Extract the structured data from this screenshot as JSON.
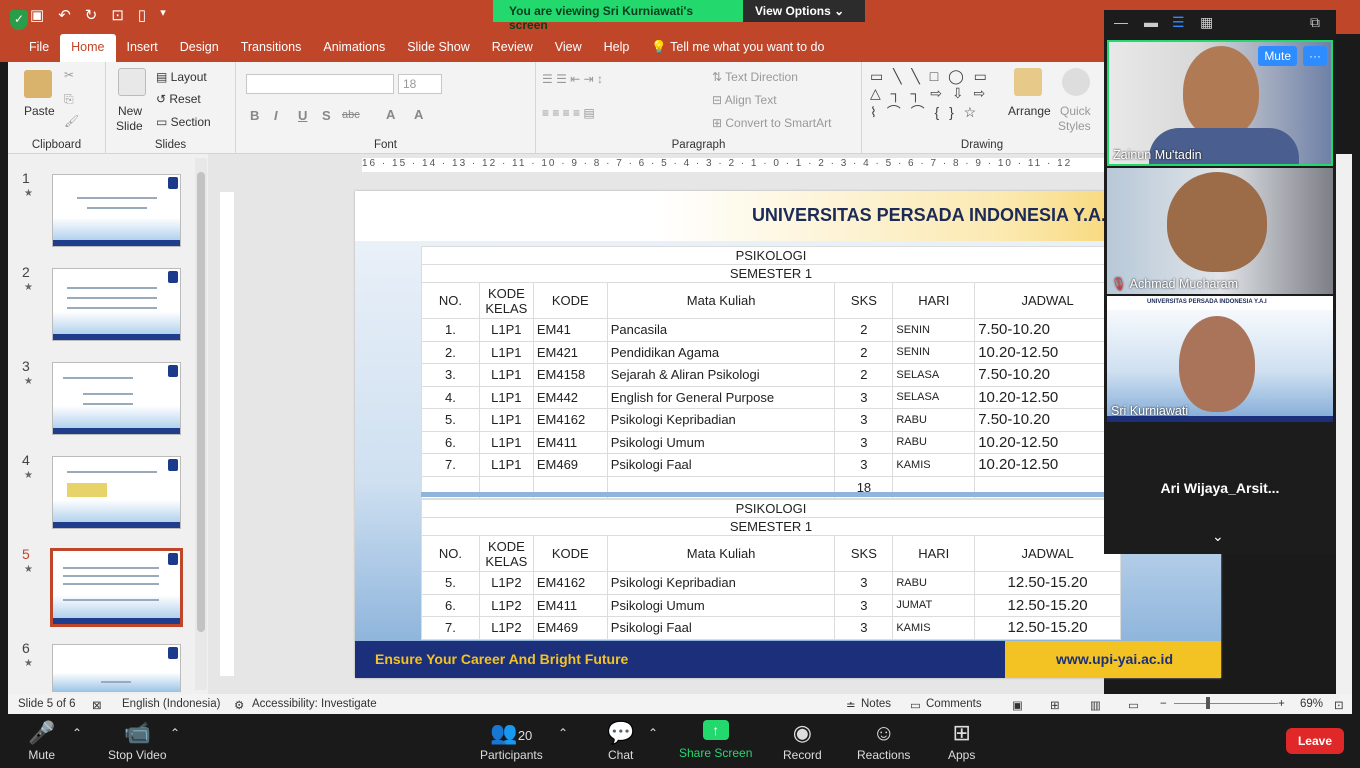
{
  "window": {
    "quick_access": [
      "save-icon",
      "undo-icon",
      "redo-icon",
      "present-icon",
      "new-icon",
      "customize-icon"
    ],
    "share_banner": "You are viewing Sri Kurniawati's screen",
    "view_options": "View Options"
  },
  "ribbon": {
    "tabs": [
      "File",
      "Home",
      "Insert",
      "Design",
      "Transitions",
      "Animations",
      "Slide Show",
      "Review",
      "View",
      "Help"
    ],
    "active_tab": "Home",
    "tell_me": "Tell me what you want to do",
    "clipboard": {
      "paste": "Paste",
      "label": "Clipboard"
    },
    "slides": {
      "new_slide_1": "New",
      "new_slide_2": "Slide",
      "layout": "Layout",
      "reset": "Reset",
      "section": "Section",
      "label": "Slides"
    },
    "font": {
      "size": "18",
      "label": "Font",
      "bold": "B",
      "italic": "I",
      "underline": "U",
      "shadow": "S",
      "strike": "abc"
    },
    "paragraph": {
      "text_direction": "Text Direction",
      "align_text": "Align Text",
      "convert_smartart": "Convert to SmartArt",
      "label": "Paragraph"
    },
    "drawing": {
      "arrange": "Arrange",
      "quick_styles_1": "Quick",
      "quick_styles_2": "Styles",
      "label": "Drawing"
    }
  },
  "ruler": {
    "horizontal": "16 · 15 · 14 · 13 · 12 · 11 · 10 · 9 · 8 · 7 · 6 · 5 · 4 · 3 · 2 · 1 · 0 · 1 · 2 · 3 · 4 · 5 · 6 · 7 · 8 · 9 · 10 · 11 · 12"
  },
  "thumbnails": [
    {
      "num": "1",
      "star": "★"
    },
    {
      "num": "2",
      "star": "★"
    },
    {
      "num": "3",
      "star": "★"
    },
    {
      "num": "4",
      "star": "★"
    },
    {
      "num": "5",
      "star": "★"
    },
    {
      "num": "6",
      "star": "★"
    }
  ],
  "slide": {
    "title": "UNIVERSITAS PERSADA INDONESIA Y.A.I",
    "footer_left": "Ensure Your Career And Bright Future",
    "footer_right": "www.upi-yai.ac.id",
    "table1": {
      "dept": "PSIKOLOGI",
      "semester": "SEMESTER 1",
      "headers": {
        "no": "NO.",
        "kode_kelas_1": "KODE",
        "kode_kelas_2": "KELAS",
        "kode": "KODE",
        "mk": "Mata Kuliah",
        "sks": "SKS",
        "hari": "HARI",
        "jadwal": "JADWAL"
      },
      "rows": [
        {
          "no": "1.",
          "kk": "L1P1",
          "kode": "EM41",
          "mk": "Pancasila",
          "sks": "2",
          "hari": "SENIN",
          "jadwal": "7.50-10.20"
        },
        {
          "no": "2.",
          "kk": "L1P1",
          "kode": "EM421",
          "mk": "Pendidikan Agama",
          "sks": "2",
          "hari": "SENIN",
          "jadwal": "10.20-12.50"
        },
        {
          "no": "3.",
          "kk": "L1P1",
          "kode": "EM4158",
          "mk": "Sejarah & Aliran Psikologi",
          "sks": "2",
          "hari": "SELASA",
          "jadwal": "7.50-10.20"
        },
        {
          "no": "4.",
          "kk": "L1P1",
          "kode": "EM442",
          "mk": "English for General Purpose",
          "sks": "3",
          "hari": "SELASA",
          "jadwal": "10.20-12.50"
        },
        {
          "no": "5.",
          "kk": "L1P1",
          "kode": "EM4162",
          "mk": "Psikologi Kepribadian",
          "sks": "3",
          "hari": "RABU",
          "jadwal": "7.50-10.20"
        },
        {
          "no": "6.",
          "kk": "L1P1",
          "kode": "EM411",
          "mk": "Psikologi Umum",
          "sks": "3",
          "hari": "RABU",
          "jadwal": "10.20-12.50"
        },
        {
          "no": "7.",
          "kk": "L1P1",
          "kode": "EM469",
          "mk": "Psikologi  Faal",
          "sks": "3",
          "hari": "KAMIS",
          "jadwal": "10.20-12.50"
        }
      ],
      "total_sks": "18"
    },
    "table2": {
      "dept": "PSIKOLOGI",
      "semester": "SEMESTER 1",
      "headers": {
        "no": "NO.",
        "kode_kelas_1": "KODE",
        "kode_kelas_2": "KELAS",
        "kode": "KODE",
        "mk": "Mata Kuliah",
        "sks": "SKS",
        "hari": "HARI",
        "jadwal": "JADWAL"
      },
      "rows": [
        {
          "no": "5.",
          "kk": "L1P2",
          "kode": "EM4162",
          "mk": "Psikologi Kepribadian",
          "sks": "3",
          "hari": "RABU",
          "jadwal": "12.50-15.20"
        },
        {
          "no": "6.",
          "kk": "L1P2",
          "kode": "EM411",
          "mk": "Psikologi Umum",
          "sks": "3",
          "hari": "JUMAT",
          "jadwal": "12.50-15.20"
        },
        {
          "no": "7.",
          "kk": "L1P2",
          "kode": "EM469",
          "mk": "Psikologi  Faal",
          "sks": "3",
          "hari": "KAMIS",
          "jadwal": "12.50-15.20"
        }
      ]
    }
  },
  "statusbar": {
    "slide_count": "Slide 5 of 6",
    "language": "English (Indonesia)",
    "accessibility": "Accessibility: Investigate",
    "notes": "Notes",
    "comments": "Comments",
    "zoom": "69%"
  },
  "participants": [
    {
      "name": "Zainun Mu'tadin",
      "mute": "Mute",
      "more": "···"
    },
    {
      "name": "Achmad Mucharam"
    },
    {
      "name": "Sri Kurniawati",
      "banner": "UNIVERSITAS PERSADA INDONESIA Y.A.I"
    },
    {
      "name": "Ari  Wijaya_Arsit..."
    }
  ],
  "zoom_toolbar": {
    "mute": "Mute",
    "stop_video": "Stop Video",
    "participants": "Participants",
    "participant_count": "20",
    "chat": "Chat",
    "share_screen": "Share Screen",
    "record": "Record",
    "reactions": "Reactions",
    "apps": "Apps",
    "leave": "Leave"
  },
  "colors": {
    "ppt_accent": "#c0462a",
    "zoom_green": "#23d96e",
    "slide_navy": "#1b2f7a",
    "slide_gold": "#f3c324",
    "leave_red": "#e02828"
  }
}
